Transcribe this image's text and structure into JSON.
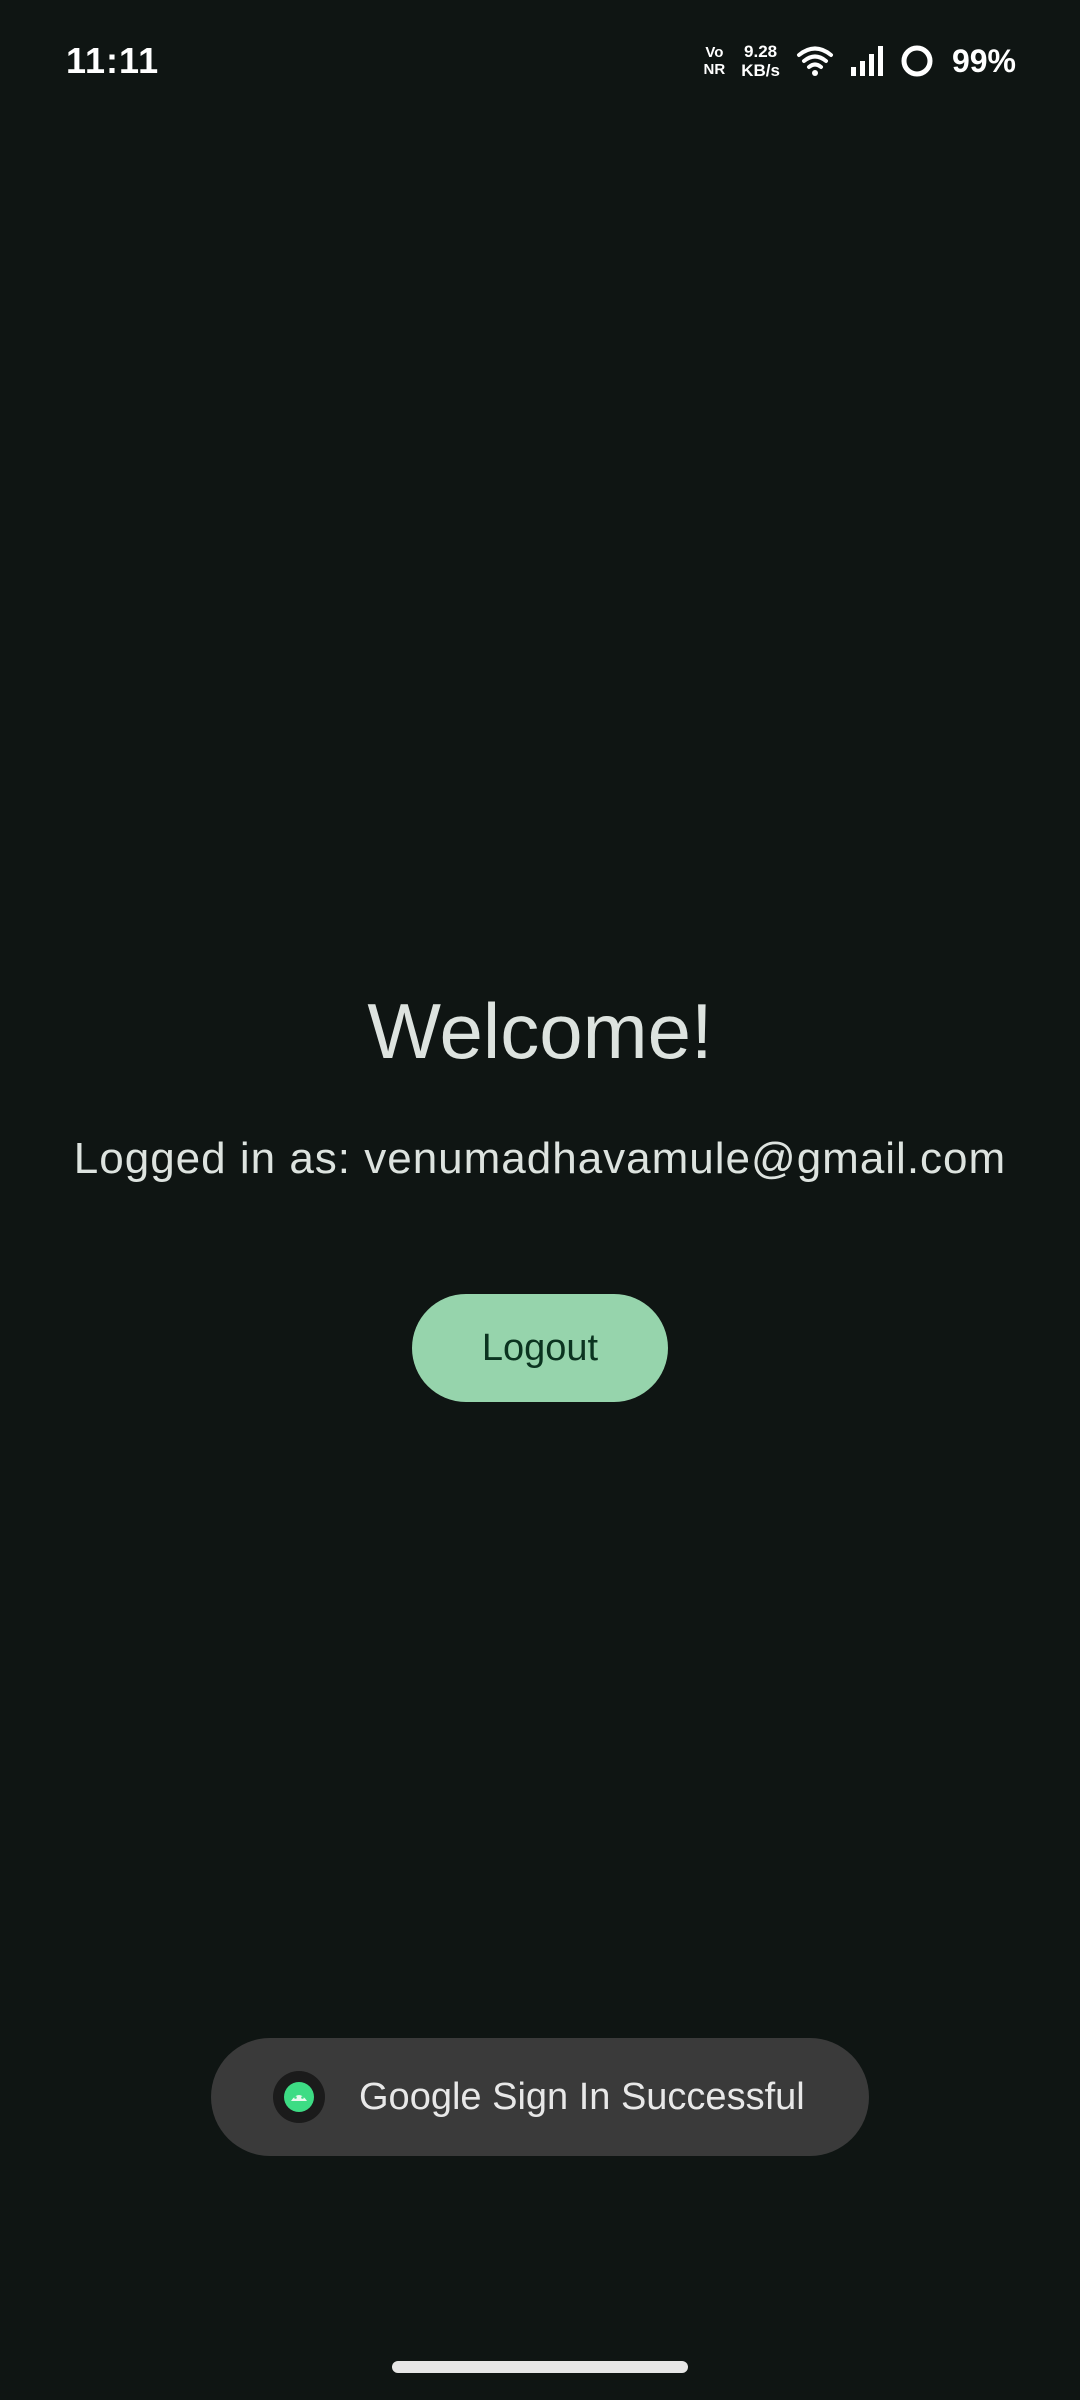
{
  "status_bar": {
    "time": "11:11",
    "volte_top": "Vo",
    "volte_bottom": "NR",
    "net_speed_value": "9.28",
    "net_speed_unit": "KB/s",
    "battery_percent": "99%",
    "icons": [
      "wifi-icon",
      "signal-icon",
      "battery-ring-icon"
    ]
  },
  "main": {
    "title": "Welcome!",
    "logged_in_text": "Logged in as: venumadhavamule@gmail.com",
    "logout_label": "Logout"
  },
  "toast": {
    "icon": "android-app-icon",
    "message": "Google Sign In Successful"
  },
  "colors": {
    "background": "#0f1513",
    "button": "#96d4ac",
    "button_text": "#0b3320",
    "toast_bg": "#3a3a3a"
  }
}
